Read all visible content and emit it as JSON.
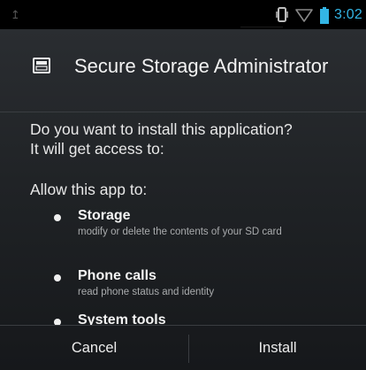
{
  "status_bar": {
    "notification_icon": "usb-icon",
    "time": "3:02",
    "accent_color": "#33b5e5",
    "icons": [
      "vibrate-icon",
      "wifi-icon",
      "battery-icon"
    ]
  },
  "dialog": {
    "title": "Secure Storage Administrator",
    "app_icon": "app-icon",
    "question_line1": "Do you want to install this application?",
    "question_line2": "It will get access to:",
    "allow_label": "Allow this app to:",
    "permissions": [
      {
        "name": "Storage",
        "description": "modify or delete the contents of your SD card"
      },
      {
        "name": "Phone calls",
        "description": "read phone status and identity"
      },
      {
        "name": "System tools",
        "description": ""
      }
    ],
    "cancel_label": "Cancel",
    "install_label": "Install"
  }
}
